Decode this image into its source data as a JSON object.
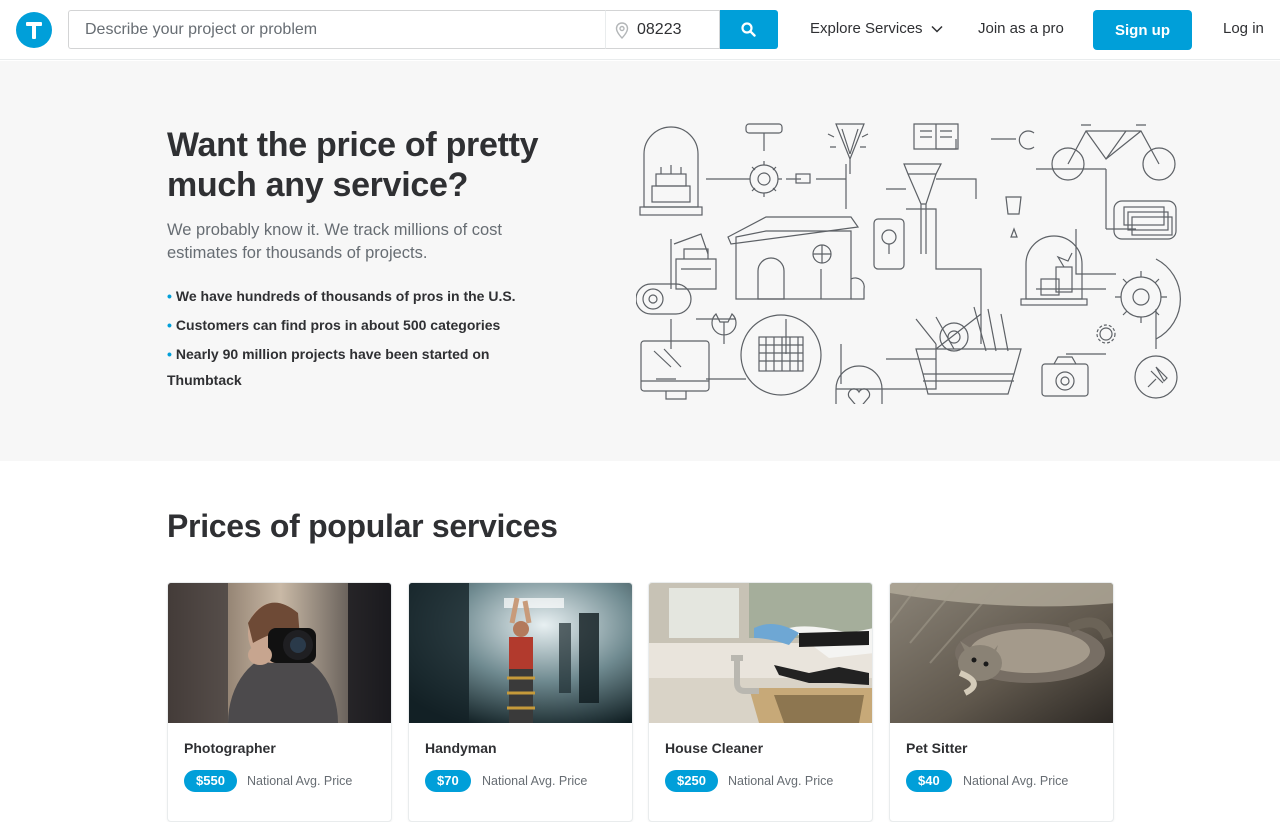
{
  "header": {
    "search_placeholder": "Describe your project or problem",
    "zip_value": "08223",
    "explore_label": "Explore Services",
    "join_label": "Join as a pro",
    "signup_label": "Sign up",
    "login_label": "Log in",
    "accent": "#009fd9"
  },
  "hero": {
    "title": "Want the price of pretty much any service?",
    "subtitle": "We probably know it. We track millions of cost estimates for thousands of projects.",
    "bullets": [
      "We have hundreds of thousands of pros in the U.S.",
      "Customers can find pros in about 500 categories",
      "Nearly 90 million projects have been started on Thumbtack"
    ]
  },
  "popular": {
    "title": "Prices of popular services",
    "cards": [
      {
        "name": "Photographer",
        "price": "$550",
        "price_label": "National Avg. Price",
        "image": "photographer-photo"
      },
      {
        "name": "Handyman",
        "price": "$70",
        "price_label": "National Avg. Price",
        "image": "handyman-photo"
      },
      {
        "name": "House Cleaner",
        "price": "$250",
        "price_label": "National Avg. Price",
        "image": "house-cleaner-photo"
      },
      {
        "name": "Pet Sitter",
        "price": "$40",
        "price_label": "National Avg. Price",
        "image": "pet-sitter-photo"
      }
    ]
  }
}
